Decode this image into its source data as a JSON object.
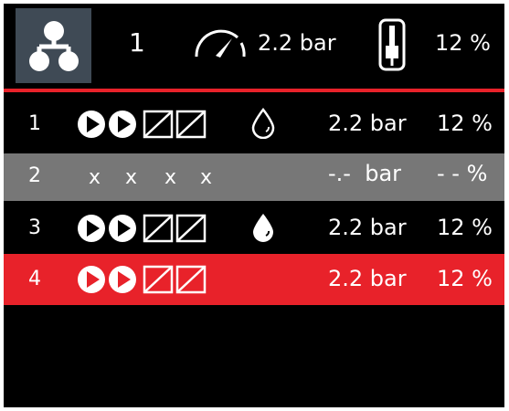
{
  "header": {
    "group_icon": "group-network-icon",
    "count": "1",
    "pressure": "2.2 bar",
    "percent": "12 %",
    "gauge_icon": "pressure-gauge-icon",
    "valve_icon": "valve-position-icon"
  },
  "colors": {
    "accent": "#e8222a",
    "row_disabled": "#777777",
    "background": "#000000",
    "header_button": "#3f4a55"
  },
  "rows": [
    {
      "number": "1",
      "pressure": "2.2 bar",
      "percent": "12 %",
      "drop": "drop-outline-icon"
    },
    {
      "number": "2",
      "pressure": "-.-  bar",
      "percent": "- - %",
      "marks": [
        "x",
        "x",
        "x",
        "x"
      ]
    },
    {
      "number": "3",
      "pressure": "2.2 bar",
      "percent": "12 %",
      "drop": "drop-filled-icon"
    },
    {
      "number": "4",
      "pressure": "2.2 bar",
      "percent": "12 %"
    }
  ]
}
